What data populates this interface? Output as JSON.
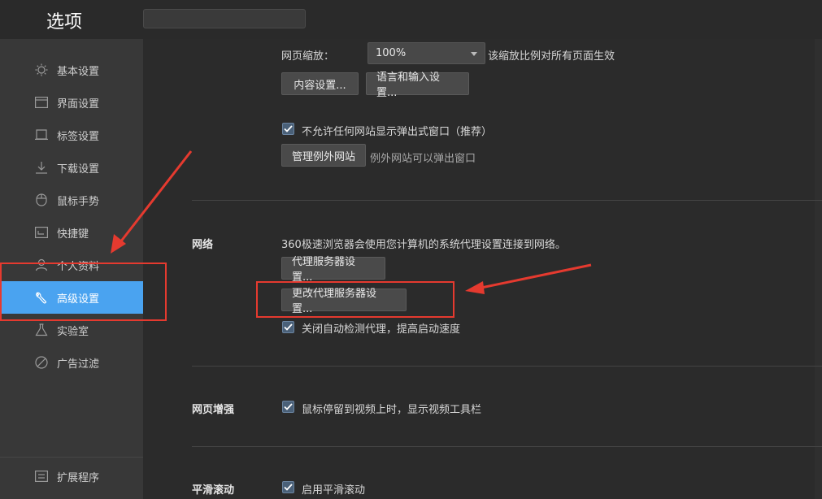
{
  "window": {
    "title": "选项",
    "search": {
      "value": "",
      "placeholder": ""
    }
  },
  "sidebar": {
    "items": [
      {
        "label": "基本设置",
        "icon": "sun-icon"
      },
      {
        "label": "界面设置",
        "icon": "window-icon"
      },
      {
        "label": "标签设置",
        "icon": "tab-icon"
      },
      {
        "label": "下载设置",
        "icon": "download-icon"
      },
      {
        "label": "鼠标手势",
        "icon": "mouse-icon"
      },
      {
        "label": "快捷键",
        "icon": "keyboard-icon"
      },
      {
        "label": "个人资料",
        "icon": "user-icon"
      },
      {
        "label": "高级设置",
        "icon": "wrench-icon",
        "active": true
      },
      {
        "label": "实验室",
        "icon": "flask-icon"
      },
      {
        "label": "广告过滤",
        "icon": "block-icon"
      }
    ],
    "footer": {
      "label": "扩展程序",
      "icon": "extension-icon"
    }
  },
  "content": {
    "zoom": {
      "label": "网页缩放：",
      "value": "100%",
      "hint": "该缩放比例对所有页面生效"
    },
    "content_settings_button": "内容设置...",
    "language_button": "语言和输入设置...",
    "popup": {
      "checkbox_label": "不允许任何网站显示弹出式窗口（推荐）",
      "checked": true,
      "manage_button": "管理例外网站",
      "manage_hint": "例外网站可以弹出窗口"
    },
    "network": {
      "title": "网络",
      "description": "360极速浏览器会使用您计算机的系统代理设置连接到网络。",
      "proxy_button": "代理服务器设置...",
      "change_proxy_button": "更改代理服务器设置...",
      "auto_detect_label": "关闭自动检测代理，提高启动速度",
      "auto_detect_checked": true
    },
    "web_enhance": {
      "title": "网页增强",
      "video_toolbar_label": "鼠标停留到视频上时，显示视频工具栏",
      "checked": true
    },
    "smooth_scroll": {
      "title": "平滑滚动",
      "label": "启用平滑滚动",
      "checked": true
    }
  },
  "colors": {
    "accent": "#4aa3f0",
    "annotation": "#e53a2f"
  }
}
